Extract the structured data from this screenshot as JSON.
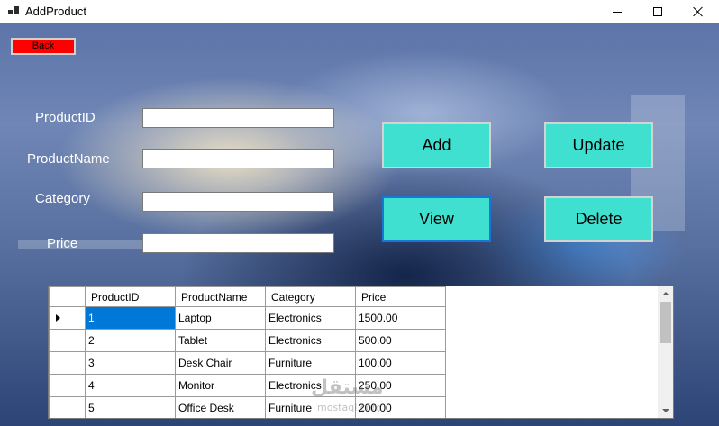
{
  "window": {
    "title": "AddProduct"
  },
  "form": {
    "back_label": "Back",
    "fields": [
      {
        "label": "ProductID",
        "value": ""
      },
      {
        "label": "ProductName",
        "value": ""
      },
      {
        "label": "Category",
        "value": ""
      },
      {
        "label": "Price",
        "value": ""
      }
    ],
    "buttons": {
      "add": "Add",
      "update": "Update",
      "view": "View",
      "delete": "Delete"
    }
  },
  "grid": {
    "columns": [
      "ProductID",
      "ProductName",
      "Category",
      "Price"
    ],
    "rows": [
      [
        "1",
        "Laptop",
        "Electronics",
        "1500.00"
      ],
      [
        "2",
        "Tablet",
        "Electronics",
        "500.00"
      ],
      [
        "3",
        "Desk Chair",
        "Furniture",
        "100.00"
      ],
      [
        "4",
        "Monitor",
        "Electronics",
        "250.00"
      ],
      [
        "5",
        "Office Desk",
        "Furniture",
        "200.00"
      ]
    ],
    "selected_row": 0
  },
  "watermark": {
    "text": "مستقل",
    "sub": "mostaql.com"
  },
  "colors": {
    "back_button": "#ff0000",
    "action_button": "#40e0d0",
    "selection": "#0078d7"
  }
}
